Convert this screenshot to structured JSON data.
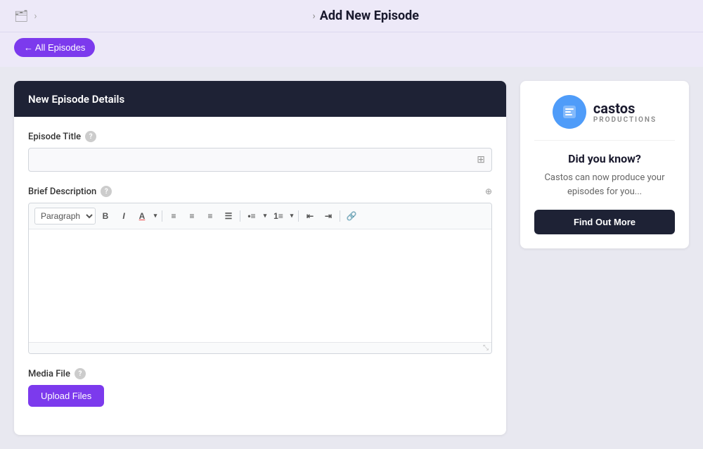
{
  "topbar": {
    "icon": "🗂",
    "chevron": ">",
    "title_chevron": ">",
    "title": "Add New Episode"
  },
  "nav": {
    "back_label": "← All Episodes"
  },
  "panel": {
    "header_title": "New Episode Details",
    "episode_title_label": "Episode Title",
    "brief_description_label": "Brief Description",
    "media_file_label": "Media File",
    "upload_btn_label": "Upload Files",
    "paragraph_option": "Paragraph",
    "toolbar": {
      "bold": "B",
      "italic": "I",
      "color_btn": "A",
      "align_left": "≡",
      "align_center": "≡",
      "align_right": "≡",
      "align_justify": "≡",
      "list_bullet": "•",
      "list_numbered": "1.",
      "indent_left": "⇤",
      "indent_right": "⇥",
      "link": "🔗"
    }
  },
  "info_card": {
    "castos_name": "castos",
    "castos_sub": "PRODUCTIONS",
    "heading": "Did you know?",
    "body": "Castos can now produce your episodes for you...",
    "find_out_label": "Find Out More"
  }
}
